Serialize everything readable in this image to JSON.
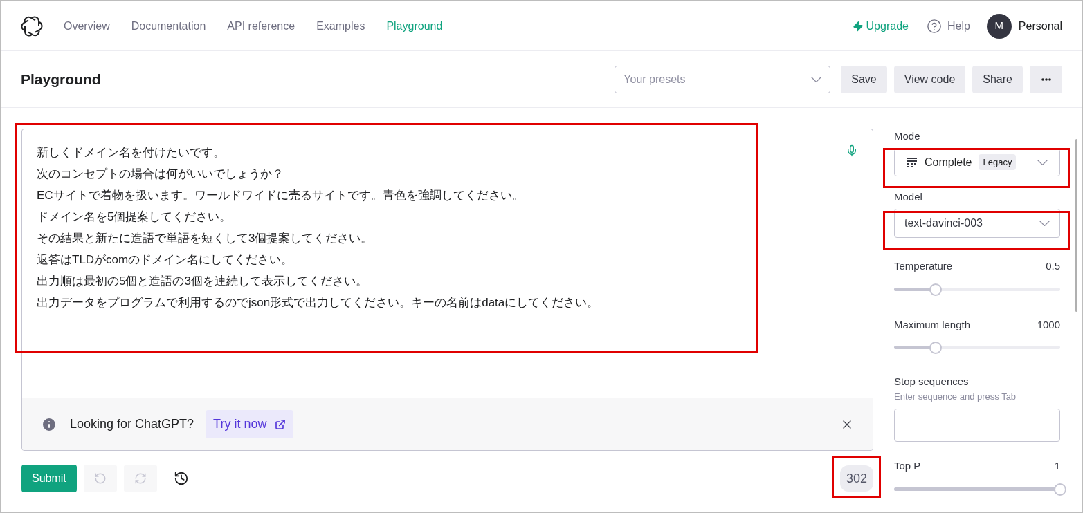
{
  "nav": {
    "links": [
      {
        "label": "Overview",
        "selected": false
      },
      {
        "label": "Documentation",
        "selected": false
      },
      {
        "label": "API reference",
        "selected": false
      },
      {
        "label": "Examples",
        "selected": false
      },
      {
        "label": "Playground",
        "selected": true
      }
    ],
    "upgrade": "Upgrade",
    "help": "Help",
    "avatar": "M",
    "account": "Personal"
  },
  "toolbar": {
    "title": "Playground",
    "presets": {
      "placeholder": "Your presets"
    },
    "buttons": [
      "Save",
      "View code",
      "Share"
    ]
  },
  "prompt": {
    "lines": [
      "新しくドメイン名を付けたいです。",
      "次のコンセプトの場合は何がいいでしょうか？",
      "ECサイトで着物を扱います。ワールドワイドに売るサイトです。青色を強調してください。",
      "ドメイン名を5個提案してください。",
      "その結果と新たに造語で単語を短くして3個提案してください。",
      "返答はTLDがcomのドメイン名にしてください。",
      "出力順は最初の5個と造語の3個を連続して表示してください。",
      "出力データをプログラムで利用するのでjson形式で出力してください。キーの名前はdataにしてください。"
    ],
    "banner": {
      "text": "Looking for ChatGPT?",
      "link": "Try it now"
    }
  },
  "actions": {
    "submit": "Submit",
    "undo_disabled": true,
    "redo_disabled": true,
    "token_count": "302"
  },
  "settings": {
    "mode": {
      "label": "Mode",
      "value": "Complete",
      "badge": "Legacy"
    },
    "model": {
      "label": "Model",
      "value": "text-davinci-003"
    },
    "sliders": [
      {
        "label": "Temperature",
        "reading": "0.5",
        "level": 0.25
      },
      {
        "label": "Maximum length",
        "reading": "1000",
        "level": 0.25
      }
    ],
    "stop": {
      "label": "Stop sequences",
      "hint": "Enter sequence and press Tab"
    },
    "top_p": {
      "label": "Top P",
      "reading": "1",
      "level": 1
    }
  }
}
